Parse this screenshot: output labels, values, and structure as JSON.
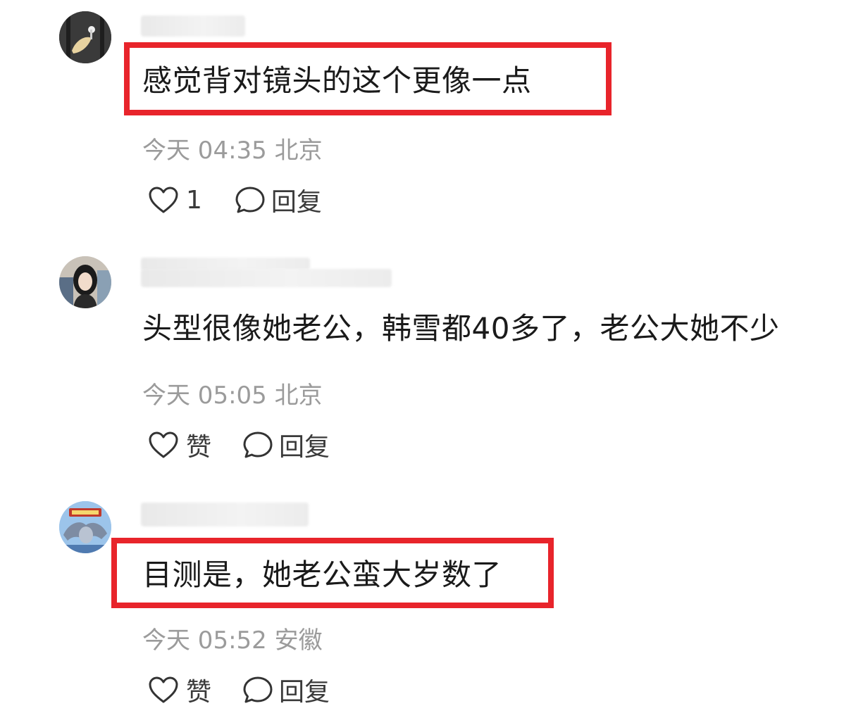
{
  "comments": [
    {
      "text": "感觉背对镜头的这个更像一点",
      "time": "今天 04:35",
      "location": "北京",
      "like_label": "1",
      "reply_label": "回复",
      "highlighted": true
    },
    {
      "text": "头型很像她老公，韩雪都40多了，老公大她不少",
      "time": "今天 05:05",
      "location": "北京",
      "like_label": "赞",
      "reply_label": "回复",
      "highlighted": false
    },
    {
      "text": "目测是，她老公蛮大岁数了",
      "time": "今天 05:52",
      "location": "安徽",
      "like_label": "赞",
      "reply_label": "回复",
      "highlighted": true
    }
  ],
  "icons": {
    "like": "heart-outline-icon",
    "reply": "speech-bubble-icon"
  },
  "colors": {
    "highlight_border": "#e8242b",
    "meta_text": "#9b9b9b"
  }
}
